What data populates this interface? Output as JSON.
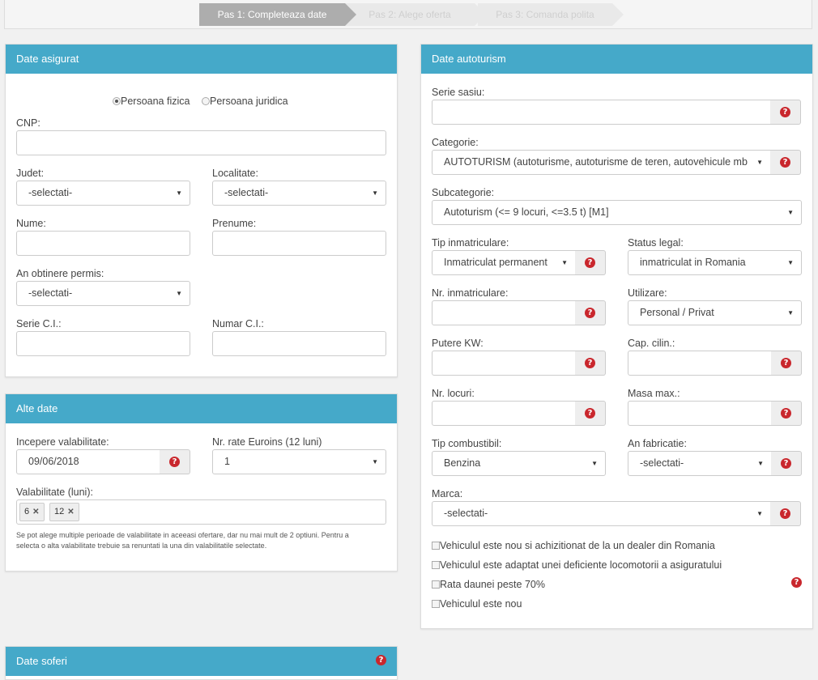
{
  "steps": [
    {
      "label": "Pas 1: Completeaza date"
    },
    {
      "label": "Pas 2: Alege oferta"
    },
    {
      "label": "Pas 3: Comanda polita"
    }
  ],
  "asigurat": {
    "title": "Date asigurat",
    "radio_fizica": "Persoana fizica",
    "radio_juridica": "Persoana juridica",
    "cnp_label": "CNP:",
    "judet_label": "Judet:",
    "judet_value": "-selectati-",
    "localitate_label": "Localitate:",
    "localitate_value": "-selectati-",
    "nume_label": "Nume:",
    "prenume_label": "Prenume:",
    "permis_label": "An obtinere permis:",
    "permis_value": "-selectati-",
    "serie_ci_label": "Serie C.I.:",
    "numar_ci_label": "Numar C.I.:"
  },
  "alte": {
    "title": "Alte date",
    "incepere_label": "Incepere valabilitate:",
    "incepere_value": "09/06/2018",
    "rate_label": "Nr. rate Euroins (12 luni)",
    "rate_value": "1",
    "valabilitate_label": "Valabilitate (luni):",
    "tags": [
      "6",
      "12"
    ],
    "note_line1": "Se pot alege multiple perioade de valabilitate in aceeasi ofertare, dar nu mai mult de 2 optiuni. Pentru a",
    "note_line2": "selecta o alta valabilitate trebuie sa renuntati la una din valabilitatile selectate."
  },
  "soferi": {
    "title": "Date soferi"
  },
  "auto": {
    "title": "Date autoturism",
    "serie_sasiu_label": "Serie sasiu:",
    "categorie_label": "Categorie:",
    "categorie_value": "AUTOTURISM (autoturisme, autoturisme de teren, autovehicule mb",
    "subcategorie_label": "Subcategorie:",
    "subcategorie_value": "Autoturism (<= 9 locuri, <=3.5 t) [M1]",
    "tip_inm_label": "Tip inmatriculare:",
    "tip_inm_value": "Inmatriculat permanent",
    "status_label": "Status legal:",
    "status_value": "inmatriculat in Romania",
    "nr_inm_label": "Nr. inmatriculare:",
    "utilizare_label": "Utilizare:",
    "utilizare_value": "Personal / Privat",
    "putere_label": "Putere KW:",
    "cap_label": "Cap. cilin.:",
    "locuri_label": "Nr. locuri:",
    "masa_label": "Masa max.:",
    "combustibil_label": "Tip combustibil:",
    "combustibil_value": "Benzina",
    "an_fab_label": "An fabricatie:",
    "an_fab_value": "-selectati-",
    "marca_label": "Marca:",
    "marca_value": "-selectati-",
    "check1": "Vehiculul este nou si achizitionat de la un dealer din Romania",
    "check2": "Vehiculul este adaptat unei deficiente locomotorii a asiguratului",
    "check3": "Rata daunei peste 70%",
    "check4": "Vehiculul este nou"
  },
  "icons": {
    "help": "question-circle-icon",
    "select": "caret-down-icon",
    "remove": "close-icon"
  },
  "colors": {
    "header": "#45a9c9",
    "help": "#c9272d",
    "step_active": "#adadad"
  }
}
